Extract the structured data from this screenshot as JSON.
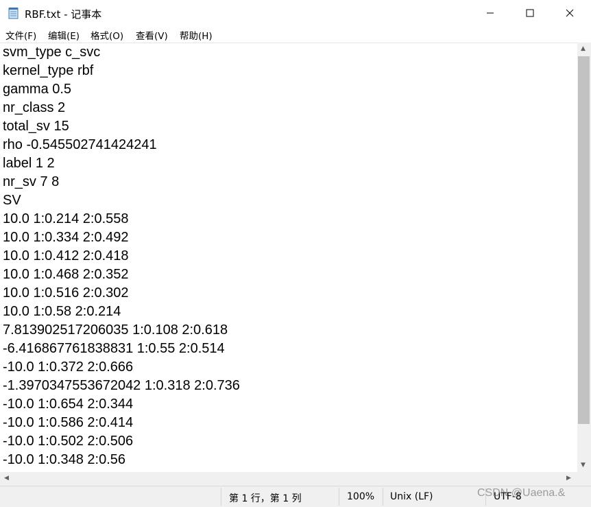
{
  "window": {
    "title": "RBF.txt - 记事本"
  },
  "menu": [
    "文件(F)",
    "编辑(E)",
    "格式(O)",
    "查看(V)",
    "帮助(H)"
  ],
  "lines": [
    "svm_type c_svc",
    "kernel_type rbf",
    "gamma 0.5",
    "nr_class 2",
    "total_sv 15",
    "rho -0.545502741424241",
    "label 1 2",
    "nr_sv 7 8",
    "SV",
    "10.0 1:0.214 2:0.558",
    "10.0 1:0.334 2:0.492",
    "10.0 1:0.412 2:0.418",
    "10.0 1:0.468 2:0.352",
    "10.0 1:0.516 2:0.302",
    "10.0 1:0.58 2:0.214",
    "7.81390251720603​5 1:0.108 2:0.618",
    "-6.416867761838831 1:0.55 2:0.514",
    "-10.0 1:0.372 2:0.666",
    "-1.3970347553672042 1:0.318 2:0.736",
    "-10.0 1:0.654 2:0.344",
    "-10.0 1:0.586 2:0.414",
    "-10.0 1:0.502 2:0.506",
    "-10.0 1:0.348 2:0.56"
  ],
  "status": {
    "position": "第 1 行，第 1 列",
    "zoom": "100%",
    "line_ending": "Unix (LF)",
    "encoding": "UTF-8"
  },
  "watermark": "CSDN @Uaena.&"
}
